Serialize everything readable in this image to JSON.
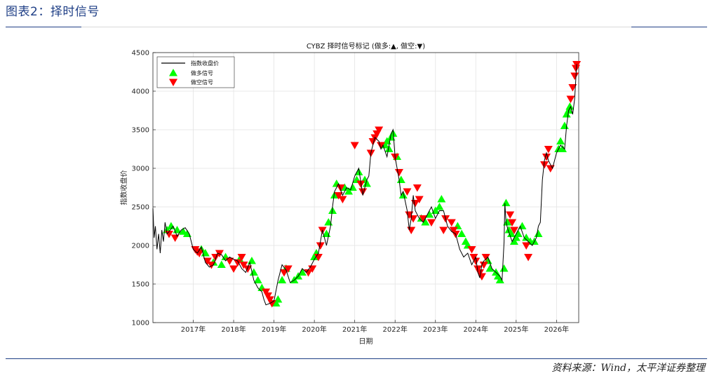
{
  "page": {
    "heading": "图表2：择时信号",
    "source": "资料来源：Wind，太平洋证券整理"
  },
  "colors": {
    "heading": "#1f3f86",
    "long_signal": "#00ff00",
    "short_signal": "#ff0000",
    "price_line": "#000000"
  },
  "chart_data": {
    "type": "line",
    "title": "CYBZ 择时信号标记 (做多:▲, 做空:▼)",
    "xlabel": "日期",
    "ylabel": "指数收盘价",
    "ylim": [
      1000,
      4500
    ],
    "yticks": [
      1000,
      1500,
      2000,
      2500,
      3000,
      3500,
      4000,
      4500
    ],
    "xlim": [
      2016.0,
      2026.55
    ],
    "xticks": [
      {
        "value": 2017,
        "label": "2017年"
      },
      {
        "value": 2018,
        "label": "2018年"
      },
      {
        "value": 2019,
        "label": "2019年"
      },
      {
        "value": 2020,
        "label": "2020年"
      },
      {
        "value": 2021,
        "label": "2021年"
      },
      {
        "value": 2022,
        "label": "2022年"
      },
      {
        "value": 2023,
        "label": "2023年"
      },
      {
        "value": 2024,
        "label": "2024年"
      },
      {
        "value": 2025,
        "label": "2025年"
      },
      {
        "value": 2026,
        "label": "2026年"
      }
    ],
    "grid": true,
    "legend_position": "top-left",
    "legend": [
      "指数收盘价",
      "做多信号",
      "做空信号"
    ],
    "series": [
      {
        "name": "指数收盘价",
        "x": [
          2016.0,
          2016.03,
          2016.06,
          2016.1,
          2016.14,
          2016.18,
          2016.22,
          2016.26,
          2016.3,
          2016.35,
          2016.4,
          2016.5,
          2016.6,
          2016.7,
          2016.8,
          2016.9,
          2017.0,
          2017.1,
          2017.2,
          2017.3,
          2017.4,
          2017.5,
          2017.6,
          2017.7,
          2017.8,
          2017.9,
          2018.0,
          2018.1,
          2018.2,
          2018.3,
          2018.4,
          2018.5,
          2018.6,
          2018.7,
          2018.75,
          2018.8,
          2018.9,
          2019.0,
          2019.1,
          2019.2,
          2019.3,
          2019.4,
          2019.5,
          2019.6,
          2019.7,
          2019.8,
          2019.9,
          2020.0,
          2020.1,
          2020.15,
          2020.2,
          2020.3,
          2020.4,
          2020.45,
          2020.5,
          2020.6,
          2020.7,
          2020.8,
          2020.9,
          2021.0,
          2021.1,
          2021.2,
          2021.3,
          2021.35,
          2021.4,
          2021.5,
          2021.6,
          2021.65,
          2021.7,
          2021.8,
          2021.9,
          2021.95,
          2022.0,
          2022.1,
          2022.15,
          2022.2,
          2022.3,
          2022.35,
          2022.4,
          2022.45,
          2022.5,
          2022.6,
          2022.7,
          2022.8,
          2022.9,
          2023.0,
          2023.1,
          2023.2,
          2023.3,
          2023.4,
          2023.5,
          2023.6,
          2023.7,
          2023.8,
          2023.9,
          2024.0,
          2024.05,
          2024.1,
          2024.15,
          2024.2,
          2024.3,
          2024.4,
          2024.5,
          2024.6,
          2024.65,
          2024.7,
          2024.72,
          2024.75,
          2024.8,
          2024.9,
          2025.0,
          2025.1,
          2025.2,
          2025.3,
          2025.4,
          2025.5,
          2025.55,
          2025.6,
          2025.65,
          2025.7,
          2025.75,
          2025.8,
          2025.9,
          2026.0,
          2026.1,
          2026.2,
          2026.25,
          2026.3,
          2026.35,
          2026.4,
          2026.45,
          2026.5
        ],
        "y": [
          2480,
          2100,
          2250,
          1950,
          2150,
          1900,
          2200,
          2050,
          2300,
          2150,
          2180,
          2250,
          2120,
          2200,
          2230,
          2150,
          1950,
          1900,
          1980,
          1780,
          1720,
          1750,
          1900,
          1880,
          1800,
          1850,
          1820,
          1800,
          1700,
          1650,
          1780,
          1550,
          1450,
          1400,
          1300,
          1230,
          1250,
          1280,
          1550,
          1750,
          1680,
          1520,
          1550,
          1600,
          1700,
          1650,
          1720,
          1820,
          1900,
          2050,
          2200,
          2000,
          2250,
          2500,
          2700,
          2800,
          2650,
          2750,
          2720,
          2900,
          3000,
          2650,
          2850,
          2900,
          3200,
          3400,
          3350,
          3250,
          3300,
          3150,
          3450,
          3500,
          3150,
          2850,
          2650,
          2700,
          2450,
          2200,
          2350,
          2650,
          2450,
          2350,
          2300,
          2400,
          2500,
          2350,
          2450,
          2450,
          2250,
          2180,
          2150,
          1950,
          1850,
          1900,
          1750,
          1850,
          1650,
          1580,
          1750,
          1800,
          1850,
          1700,
          1650,
          1600,
          1550,
          2050,
          2550,
          2300,
          2200,
          2050,
          2150,
          2250,
          2100,
          2050,
          2000,
          2100,
          2250,
          2300,
          2850,
          3100,
          3200,
          3100,
          3000,
          3200,
          3300,
          3250,
          3550,
          3750,
          3800,
          3700,
          3900,
          4350
        ]
      },
      {
        "name": "做多信号",
        "x": [
          2016.35,
          2016.45,
          2016.6,
          2016.75,
          2016.85,
          2017.2,
          2017.3,
          2017.5,
          2017.7,
          2017.8,
          2018.15,
          2018.45,
          2018.5,
          2018.6,
          2018.7,
          2019.05,
          2019.1,
          2019.2,
          2019.3,
          2019.5,
          2019.6,
          2019.7,
          2020.0,
          2020.05,
          2020.3,
          2020.35,
          2020.45,
          2020.5,
          2020.55,
          2020.75,
          2020.85,
          2020.95,
          2021.05,
          2021.1,
          2021.25,
          2021.3,
          2021.75,
          2021.8,
          2021.85,
          2021.9,
          2021.95,
          2022.05,
          2022.15,
          2022.2,
          2022.65,
          2022.75,
          2022.85,
          2023.0,
          2023.1,
          2023.15,
          2023.55,
          2023.65,
          2023.75,
          2023.8,
          2024.3,
          2024.35,
          2024.5,
          2024.55,
          2024.6,
          2024.7,
          2024.75,
          2024.78,
          2024.82,
          2024.88,
          2024.95,
          2025.0,
          2025.05,
          2025.15,
          2025.25,
          2025.35,
          2025.45,
          2025.55,
          2026.05,
          2026.1,
          2026.15,
          2026.2,
          2026.25,
          2026.3,
          2026.33
        ],
        "y": [
          2200,
          2250,
          2200,
          2180,
          2150,
          1950,
          1900,
          1780,
          1750,
          1850,
          1820,
          1800,
          1650,
          1550,
          1450,
          1250,
          1300,
          1550,
          1700,
          1550,
          1600,
          1650,
          1850,
          1900,
          2150,
          2300,
          2450,
          2650,
          2800,
          2750,
          2700,
          2750,
          2850,
          2950,
          2850,
          2800,
          3300,
          3350,
          3250,
          3400,
          3450,
          3150,
          2850,
          2650,
          2350,
          2300,
          2400,
          2450,
          2500,
          2600,
          2250,
          2150,
          2050,
          2000,
          1800,
          1700,
          1650,
          1600,
          1550,
          1700,
          2550,
          2300,
          2200,
          2150,
          2050,
          2100,
          2150,
          2250,
          2100,
          2050,
          2050,
          2150,
          3250,
          3350,
          3250,
          3550,
          3700,
          3750,
          3800
        ]
      },
      {
        "name": "做空信号",
        "x": [
          2016.4,
          2016.55,
          2017.05,
          2017.1,
          2017.15,
          2017.35,
          2017.45,
          2017.55,
          2017.65,
          2017.9,
          2018.0,
          2018.1,
          2018.2,
          2018.25,
          2018.35,
          2018.8,
          2018.85,
          2018.9,
          2018.95,
          2019.25,
          2019.35,
          2019.85,
          2019.95,
          2020.1,
          2020.15,
          2020.2,
          2020.6,
          2020.65,
          2020.7,
          2021.0,
          2021.15,
          2021.2,
          2021.4,
          2021.45,
          2021.5,
          2021.55,
          2021.6,
          2021.65,
          2022.0,
          2022.1,
          2022.3,
          2022.35,
          2022.4,
          2022.45,
          2022.5,
          2022.55,
          2022.6,
          2022.7,
          2022.9,
          2023.2,
          2023.25,
          2023.4,
          2023.45,
          2023.5,
          2023.9,
          2023.95,
          2024.0,
          2024.05,
          2024.1,
          2024.15,
          2024.2,
          2024.25,
          2024.85,
          2024.9,
          2024.95,
          2025.25,
          2025.3,
          2025.7,
          2025.75,
          2025.8,
          2025.85,
          2026.35,
          2026.4,
          2026.45,
          2026.48,
          2026.5
        ],
        "y": [
          2150,
          2100,
          1950,
          1920,
          1900,
          1800,
          1750,
          1850,
          1900,
          1800,
          1700,
          1780,
          1850,
          1750,
          1700,
          1400,
          1350,
          1300,
          1250,
          1650,
          1700,
          1650,
          1700,
          1850,
          2000,
          2200,
          2650,
          2750,
          2600,
          3300,
          2800,
          2700,
          3200,
          3350,
          3400,
          3450,
          3500,
          3300,
          3150,
          2950,
          2700,
          2400,
          2200,
          2350,
          2550,
          2750,
          2600,
          2350,
          2300,
          2200,
          2350,
          2300,
          2200,
          2150,
          1950,
          1850,
          1800,
          1700,
          1650,
          1600,
          1750,
          1850,
          2400,
          2300,
          2200,
          2000,
          1850,
          3050,
          3150,
          3250,
          3000,
          3900,
          4050,
          4200,
          4300,
          4350
        ]
      }
    ]
  }
}
